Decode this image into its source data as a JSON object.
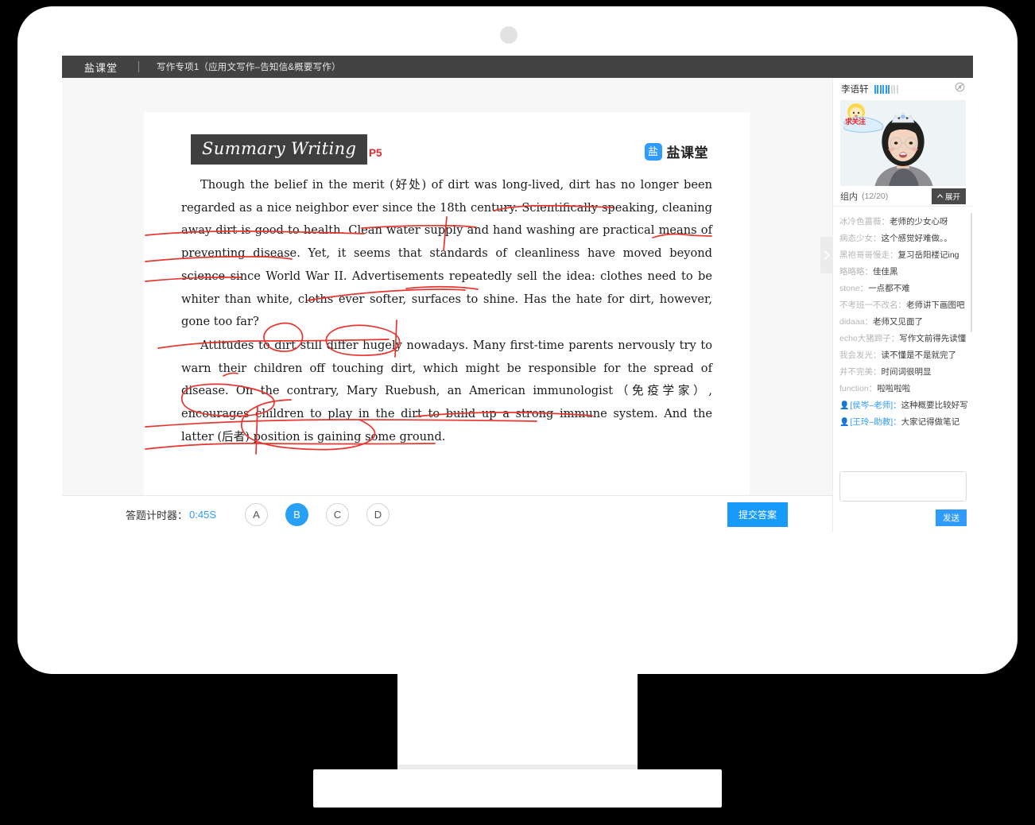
{
  "topbar": {
    "brand": "盐课堂",
    "course_title": "写作专项1（应用文写作–告知信&概要写作）"
  },
  "slide": {
    "title": "Summary Writing",
    "page_label": "P5",
    "logo_mark": "盐",
    "logo_text": "盐课堂",
    "paragraphs": [
      "Though the belief in the merit (好处) of dirt was long-lived, dirt has no longer been regarded as a nice neighbor ever since the 18th century. Scientifically speaking, cleaning away dirt is good to health. Clean water supply and hand washing are practical means of preventing disease. Yet, it seems that standards of cleanliness have moved beyond science since World War II. Advertisements repeatedly sell the idea: clothes need to be whiter than white, cloths ever softer, surfaces to shine. Has the hate for dirt, however, gone too far?",
      "Attitudes to dirt still differ hugely nowadays. Many first-time parents nervously try to warn their children off touching dirt, which might be responsible for the spread of disease. On the contrary, Mary Ruebush, an American immunologist（免疫学家）, encourages children to play in the dirt to build up a strong immune system. And the latter (后者) position is gaining some ground."
    ],
    "annotation_color": "#e8352e"
  },
  "answer_bar": {
    "timer_label": "答题计时器：",
    "timer_value": "0:45S",
    "options": [
      "A",
      "B",
      "C",
      "D"
    ],
    "selected_option": "B",
    "submit_label": "提交答案",
    "accent_color": "#169bfa"
  },
  "sidebar": {
    "user_name": "李语轩",
    "signal_on_bars": 6,
    "signal_off_bars": 3,
    "mute_icon": "mute-icon",
    "video_sticker_text": "求关注",
    "group_label": "组内",
    "group_count": "(12/20)",
    "expand_label": "展开",
    "chat": [
      {
        "user": "冰冷色蔷薇",
        "msg": "老师的少女心呀",
        "teacher": false
      },
      {
        "user": "病态少女",
        "msg": "这个感觉好难做。。",
        "teacher": false
      },
      {
        "user": "黑袍哥哥慢走",
        "msg": "复习岳阳楼记ing",
        "teacher": false
      },
      {
        "user": "略略略",
        "msg": "佳佳黑",
        "teacher": false
      },
      {
        "user": "stone",
        "msg": "一点都不难",
        "teacher": false
      },
      {
        "user": "不考班一不改名",
        "msg": "老师讲下画图吧",
        "teacher": false
      },
      {
        "user": "didaaa",
        "msg": "老师又见面了",
        "teacher": false
      },
      {
        "user": "echo大猪蹄子",
        "msg": "写作文前得先读懂",
        "teacher": false
      },
      {
        "user": "我会发光",
        "msg": "读不懂是不是就完了",
        "teacher": false
      },
      {
        "user": "并不完美",
        "msg": "时间词很明显",
        "teacher": false
      },
      {
        "user": "function",
        "msg": "啦啦啦啦",
        "teacher": false
      },
      {
        "user": "[侯岑–老师]",
        "msg": "这种概要比较好写",
        "teacher": true
      },
      {
        "user": "[王玲–助教]",
        "msg": "大家记得做笔记",
        "teacher": true
      }
    ],
    "composer_value": "",
    "composer_placeholder": "",
    "send_label": "发送"
  }
}
